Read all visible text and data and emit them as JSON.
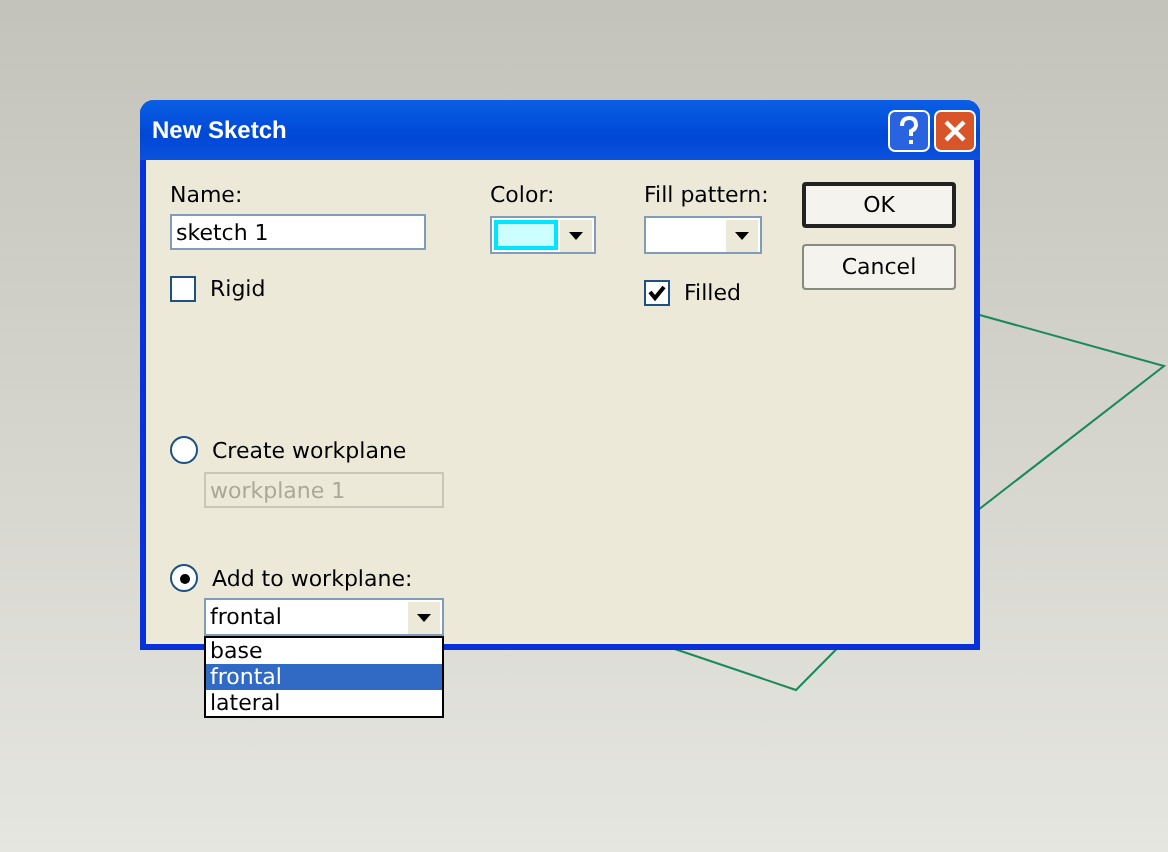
{
  "window": {
    "title": "New Sketch"
  },
  "name": {
    "label": "Name:",
    "value": "sketch 1"
  },
  "color": {
    "label": "Color:",
    "color": "#ccffff"
  },
  "fill_pattern": {
    "label": "Fill pattern:"
  },
  "checkboxes": [
    {
      "label": "Rigid",
      "checked": false
    },
    {
      "label": "Filled",
      "checked": true
    }
  ],
  "create_workplane": {
    "label": "Create workplane",
    "selected": false,
    "field": {
      "value": "workplane 1",
      "disabled": true
    }
  },
  "add_to_workplane": {
    "label": "Add to workplane:",
    "selected": true,
    "combo": {
      "value": "frontal",
      "expanded": true,
      "options": [
        {
          "label": "base",
          "selected": false
        },
        {
          "label": "frontal",
          "selected": true
        },
        {
          "label": "lateral",
          "selected": false
        }
      ]
    }
  },
  "buttons": [
    {
      "label": "OK",
      "default": true
    },
    {
      "label": "Cancel",
      "default": false
    }
  ]
}
